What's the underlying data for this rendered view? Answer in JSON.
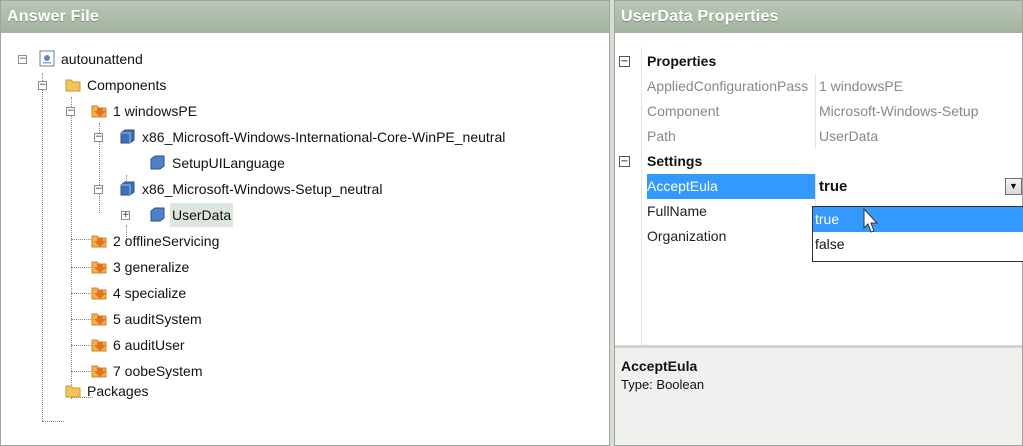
{
  "answer_file": {
    "title": "Answer File",
    "tree": [
      {
        "label": "autounattend",
        "icon": "answer-file-icon"
      },
      {
        "label": "Components",
        "icon": "folder-icon"
      },
      {
        "label": "1 windowsPE",
        "icon": "pass-icon"
      },
      {
        "label": "x86_Microsoft-Windows-International-Core-WinPE_neutral",
        "icon": "component-icon"
      },
      {
        "label": "SetupUILanguage",
        "icon": "setting-icon"
      },
      {
        "label": "x86_Microsoft-Windows-Setup_neutral",
        "icon": "component-icon"
      },
      {
        "label": "UserData",
        "icon": "setting-icon"
      },
      {
        "label": "2 offlineServicing",
        "icon": "pass-icon"
      },
      {
        "label": "3 generalize",
        "icon": "pass-icon"
      },
      {
        "label": "4 specialize",
        "icon": "pass-icon"
      },
      {
        "label": "5 auditSystem",
        "icon": "pass-icon"
      },
      {
        "label": "6 auditUser",
        "icon": "pass-icon"
      },
      {
        "label": "7 oobeSystem",
        "icon": "pass-icon"
      },
      {
        "label": "Packages",
        "icon": "folder-icon"
      }
    ]
  },
  "properties": {
    "title": "UserData Properties",
    "categories": {
      "properties": "Properties",
      "settings": "Settings"
    },
    "rows": {
      "applied": {
        "name": "AppliedConfigurationPass",
        "value": "1 windowsPE"
      },
      "component": {
        "name": "Component",
        "value": "Microsoft-Windows-Setup"
      },
      "path": {
        "name": "Path",
        "value": "UserData"
      },
      "accept_eula": {
        "name": "AcceptEula",
        "value": "true"
      },
      "full_name": {
        "name": "FullName",
        "value": ""
      },
      "organization": {
        "name": "Organization",
        "value": ""
      }
    },
    "dropdown_options": [
      "true",
      "false"
    ],
    "description": {
      "title": "AcceptEula",
      "type": "Type: Boolean"
    }
  },
  "colors": {
    "header_bg": "#a8b8a5",
    "selection": "#3399ff"
  }
}
